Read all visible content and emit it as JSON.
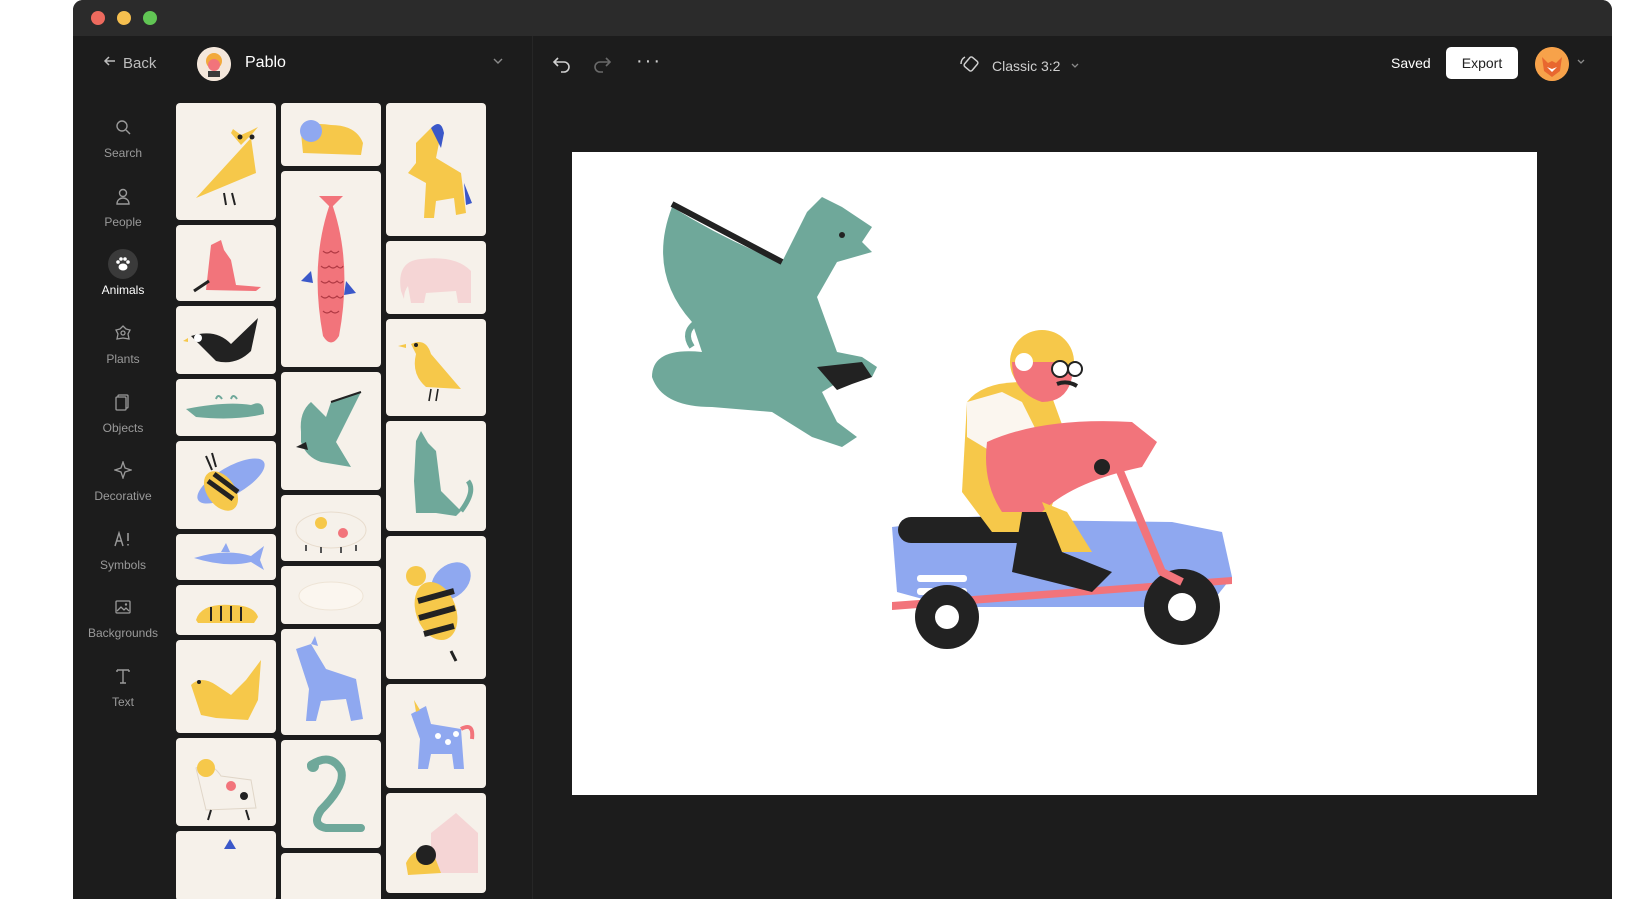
{
  "nav": {
    "back_label": "Back",
    "project_name": "Pablo"
  },
  "toolbar": {
    "more_label": "···",
    "format_label": "Classic  3:2",
    "saved_label": "Saved",
    "export_label": "Export"
  },
  "sidebar": {
    "items": [
      {
        "label": "Search",
        "icon": "search-icon"
      },
      {
        "label": "People",
        "icon": "person-icon"
      },
      {
        "label": "Animals",
        "icon": "paw-icon"
      },
      {
        "label": "Plants",
        "icon": "flower-icon"
      },
      {
        "label": "Objects",
        "icon": "objects-icon"
      },
      {
        "label": "Decorative",
        "icon": "sparkle-icon"
      },
      {
        "label": "Symbols",
        "icon": "symbols-icon"
      },
      {
        "label": "Backgrounds",
        "icon": "image-icon"
      },
      {
        "label": "Text",
        "icon": "text-icon"
      }
    ],
    "active": "Animals"
  },
  "library": {
    "items": [
      "owl",
      "lion",
      "horse",
      "fox",
      "fish",
      "elephant",
      "eagle",
      "bird",
      "crocodile",
      "dragon",
      "cat",
      "bee",
      "pig",
      "shark",
      "polar-bear",
      "bee-large",
      "tiger",
      "dog",
      "wolf",
      "unicorn",
      "dog-spotted",
      "snake",
      "doghouse"
    ]
  },
  "colors": {
    "accent_yellow": "#f6c84a",
    "accent_teal": "#6fa89a",
    "accent_pink": "#f2747b",
    "accent_blue": "#8fa8f0",
    "tile_bg": "#f6f1ea",
    "dark_bg": "#1c1c1c"
  }
}
